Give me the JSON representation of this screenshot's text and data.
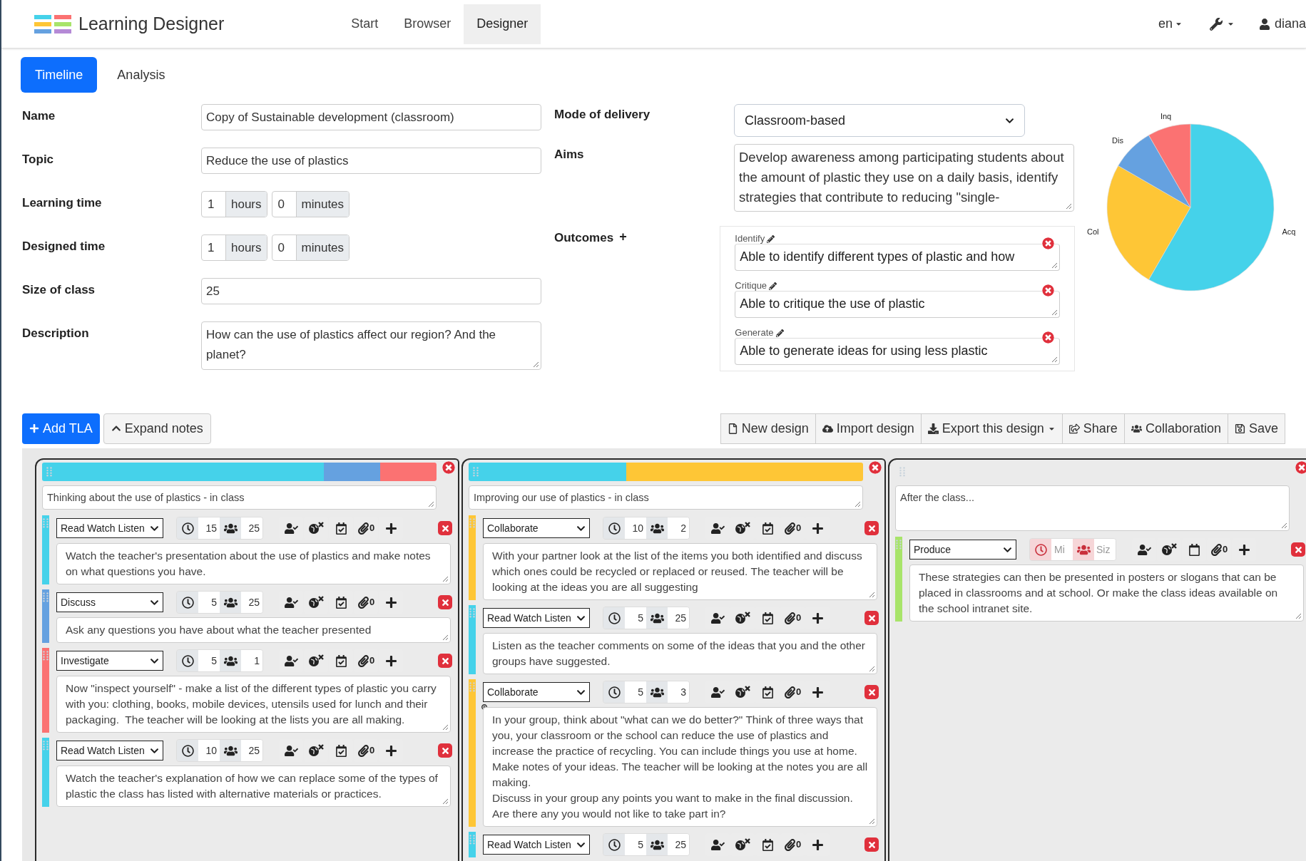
{
  "app": {
    "title": "Learning Designer"
  },
  "nav": [
    {
      "label": "Start",
      "selected": false
    },
    {
      "label": "Browser",
      "selected": false
    },
    {
      "label": "Designer",
      "selected": true
    }
  ],
  "language": "en",
  "user": "diana",
  "tabs": [
    {
      "label": "Timeline",
      "selected": true
    },
    {
      "label": "Analysis",
      "selected": false
    }
  ],
  "form": [
    {
      "kind": "text",
      "label": "Name",
      "value": "Copy of Sustainable development (classroom)"
    },
    {
      "kind": "text",
      "label": "Topic",
      "value": "Reduce the use of plastics"
    },
    {
      "kind": "duration",
      "label": "Learning time",
      "hours": "1",
      "hours_unit": "hours",
      "minutes": "0",
      "minutes_unit": "minutes"
    },
    {
      "kind": "duration",
      "label": "Designed time",
      "hours": "1",
      "hours_unit": "hours",
      "minutes": "0",
      "minutes_unit": "minutes"
    },
    {
      "kind": "text",
      "label": "Size of class",
      "value": "25"
    },
    {
      "kind": "textarea",
      "label": "Description",
      "value": "How can the use of plastics affect our region? And the planet?"
    }
  ],
  "mode_of_delivery": {
    "label": "Mode of delivery",
    "value": "Classroom-based"
  },
  "aims": {
    "label": "Aims",
    "value": "Develop awareness among participating students about the amount of plastic they use on a daily basis, identify strategies that contribute to reducing \"single-"
  },
  "outcomes": {
    "label": "Outcomes",
    "add": "+",
    "items": [
      {
        "tag": "Identify",
        "text": "Able to identify different types of plastic and how"
      },
      {
        "tag": "Critique",
        "text": "Able to critique the use of plastic"
      },
      {
        "tag": "Generate",
        "text": "Able to generate ideas for using less plastic"
      }
    ]
  },
  "chart_data": {
    "type": "pie",
    "categories": [
      "Acq",
      "Col",
      "Dis",
      "Inq"
    ],
    "series": [
      {
        "values": [
          58.34,
          25,
          8.33,
          8.33
        ]
      }
    ],
    "colors": [
      "#45d2ea",
      "#fec636",
      "#65a1e0",
      "#fb7272"
    ]
  },
  "toolbar_left": [
    {
      "label": "Add TLA",
      "kind": "primary"
    },
    {
      "label": "Expand notes",
      "kind": "default"
    }
  ],
  "toolbar_right": [
    {
      "label": "New design",
      "dropdown": false
    },
    {
      "label": "Import design",
      "dropdown": false
    },
    {
      "label": "Export this design",
      "dropdown": true
    },
    {
      "label": "Share",
      "dropdown": false
    },
    {
      "label": "Collaboration",
      "dropdown": false
    },
    {
      "label": "Save",
      "dropdown": false
    }
  ],
  "columns": [
    {
      "title": "Thinking about the use of plastics - in class",
      "tlas": [
        {
          "type": "Read Watch Listen",
          "color": "#45d2ea",
          "minutes": "15",
          "size": "25",
          "attachments": "0",
          "assessed": true,
          "description": "Watch the teacher's presentation about the use of plastics and make notes on what questions you have."
        },
        {
          "type": "Discuss",
          "color": "#65a1e0",
          "minutes": "5",
          "size": "25",
          "attachments": "0",
          "assessed": true,
          "description": "Ask any questions you have about what the teacher presented"
        },
        {
          "type": "Investigate",
          "color": "#fb7272",
          "minutes": "5",
          "size": "1",
          "attachments": "0",
          "assessed": true,
          "description": "Now \"inspect yourself\" - make a list of the different types of plastic you carry with you: clothing, books, mobile devices, utensils used for lunch and their packaging.  The teacher will be looking at the lists you are all making."
        },
        {
          "type": "Read Watch Listen",
          "color": "#45d2ea",
          "minutes": "10",
          "size": "25",
          "attachments": "0",
          "assessed": true,
          "description": "Watch the teacher's explanation of how we can replace some of the types of plastic the class has listed with alternative materials or practices."
        }
      ]
    },
    {
      "title": "Improving our use of plastics - in class",
      "tlas": [
        {
          "type": "Collaborate",
          "color": "#fec636",
          "minutes": "10",
          "size": "2",
          "attachments": "0",
          "assessed": true,
          "description": "With your partner look at the list of the items you both identified and discuss which ones could be recycled or replaced or reused. The teacher will be looking at the ideas you are all suggesting"
        },
        {
          "type": "Read Watch Listen",
          "color": "#45d2ea",
          "minutes": "5",
          "size": "25",
          "attachments": "0",
          "assessed": true,
          "description": "Listen as the teacher comments on some of the ideas that you and the other groups have suggested."
        },
        {
          "type": "Collaborate",
          "color": "#fec636",
          "minutes": "5",
          "size": "3",
          "attachments": "0",
          "assessed": true,
          "zoom_hint": true,
          "description": "In your group, think about \"what can we do better?\" Think of three ways that you, your classroom or the school can reduce the use of plastics and increase the practice of recycling. You can include things you use at home. Make notes of your ideas. The teacher will be looking at the notes you are all making.\nDiscuss in your group any points you want to make in the final discussion. Are there any you would not like to take part in?"
        },
        {
          "type": "Read Watch Listen",
          "color": "#45d2ea",
          "minutes": "5",
          "size": "25",
          "attachments": "0",
          "assessed": true
        }
      ]
    },
    {
      "title": "After the class...",
      "tlas": [
        {
          "type": "Produce",
          "color": "#a8e46a",
          "minutes_placeholder": "Mi",
          "size_placeholder": "Siz",
          "invalid": true,
          "attachments": "0",
          "assessed": false,
          "description": "These strategies can then be presented in posters or slogans that can be placed in classrooms and at school. Or make the class ideas available on the school intranet site."
        }
      ]
    }
  ]
}
